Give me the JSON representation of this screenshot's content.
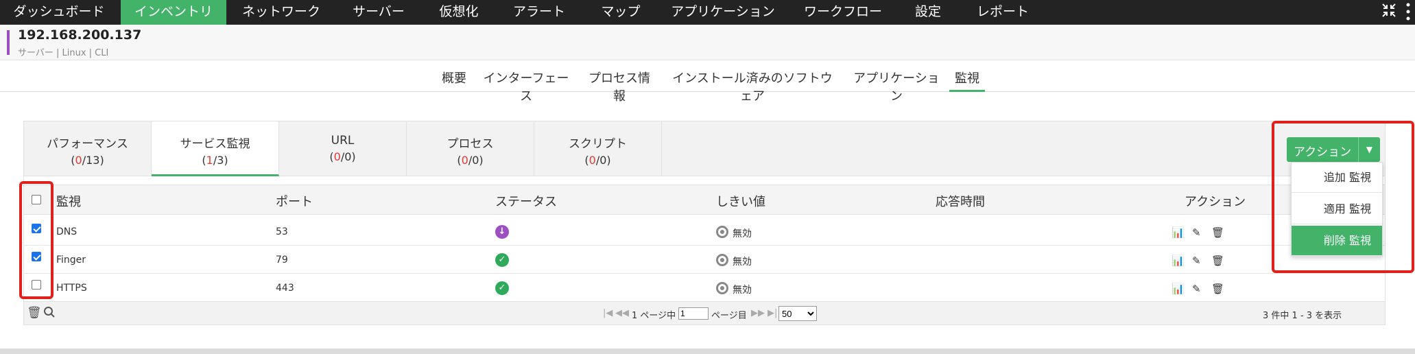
{
  "nav": {
    "items": [
      "ダッシュボード",
      "インベントリ",
      "ネットワーク",
      "サーバー",
      "仮想化",
      "アラート",
      "マップ",
      "アプリケーション",
      "ワークフロー",
      "設定",
      "レポート"
    ],
    "active_index": 1
  },
  "device": {
    "ip": "192.168.200.137",
    "meta": "サーバー | Linux | CLI"
  },
  "subtabs": {
    "items": [
      "概要",
      "インターフェース",
      "プロセス情報",
      "インストール済みのソフトウェア",
      "アプリケーション",
      "監視"
    ],
    "active_index": 5
  },
  "monitor_tabs": [
    {
      "label": "パフォーマンス",
      "count_prefix": "(",
      "count_red": "0",
      "count_suffix": "/13)"
    },
    {
      "label": "サービス監視",
      "count_prefix": "(",
      "count_red": "1",
      "count_suffix": "/3)"
    },
    {
      "label": "URL",
      "count_prefix": "(",
      "count_red": "0",
      "count_suffix": "/0)"
    },
    {
      "label": "プロセス",
      "count_prefix": "(",
      "count_red": "0",
      "count_suffix": "/0)"
    },
    {
      "label": "スクリプト",
      "count_prefix": "(",
      "count_red": "0",
      "count_suffix": "/0)"
    }
  ],
  "table": {
    "headers": {
      "monitor": "監視",
      "port": "ポート",
      "status": "ステータス",
      "threshold": "しきい値",
      "response": "応答時間",
      "action": "アクション"
    },
    "rows": [
      {
        "name": "DNS",
        "port": "53",
        "status": "down",
        "threshold": "無効",
        "checked": true
      },
      {
        "name": "Finger",
        "port": "79",
        "status": "up",
        "threshold": "無効",
        "checked": true
      },
      {
        "name": "HTTPS",
        "port": "443",
        "status": "up",
        "threshold": "無効",
        "checked": false
      }
    ]
  },
  "pager": {
    "page_prefix": "1 ページ中",
    "page_value": "1",
    "page_suffix": "ページ目",
    "per_page": "50",
    "summary": "3 件中 1 - 3 を表示"
  },
  "actions": {
    "button_label": "アクション",
    "menu": [
      "追加 監視",
      "適用 監視",
      "削除 監視"
    ],
    "highlighted_index": 2
  },
  "colors": {
    "accent": "#43b36a",
    "nav_bg": "#232323",
    "alert_red": "#e53935",
    "status_down": "#9b4fc1"
  }
}
